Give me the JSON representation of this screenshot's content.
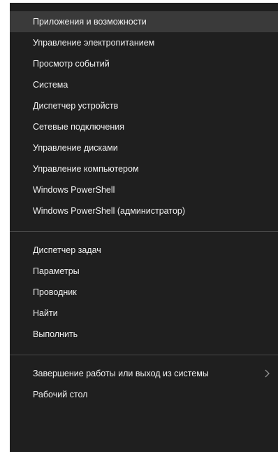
{
  "menu": {
    "group1": [
      {
        "label": "Приложения и возможности"
      },
      {
        "label": "Управление электропитанием"
      },
      {
        "label": "Просмотр событий"
      },
      {
        "label": "Система"
      },
      {
        "label": "Диспетчер устройств"
      },
      {
        "label": "Сетевые подключения"
      },
      {
        "label": "Управление дисками"
      },
      {
        "label": "Управление компьютером"
      },
      {
        "label": "Windows PowerShell"
      },
      {
        "label": "Windows PowerShell (администратор)"
      }
    ],
    "group2": [
      {
        "label": "Диспетчер задач"
      },
      {
        "label": "Параметры"
      },
      {
        "label": "Проводник"
      },
      {
        "label": "Найти"
      },
      {
        "label": "Выполнить"
      }
    ],
    "group3": [
      {
        "label": "Завершение работы или выход из системы",
        "submenu_icon": "chevron-right-icon"
      },
      {
        "label": "Рабочий стол"
      }
    ]
  },
  "colors": {
    "menu_background": "#1f1f1f",
    "hover_background": "#3a3a3a",
    "text": "#f2f2f2",
    "separator": "#4a4a4a"
  }
}
